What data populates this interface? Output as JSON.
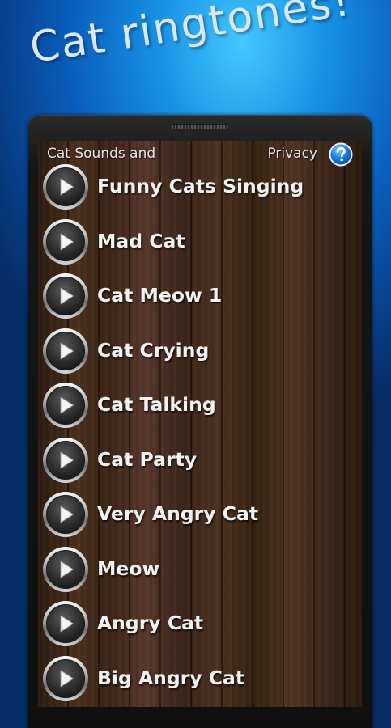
{
  "banner": {
    "title": "Cat ringtones!"
  },
  "header": {
    "left_label": "Cat Sounds and",
    "right_label": "Privacy",
    "help_icon": "question-mark-icon"
  },
  "play_icon": "play-icon",
  "sounds": [
    {
      "title": "Funny Cats Singing"
    },
    {
      "title": "Mad Cat"
    },
    {
      "title": "Cat Meow 1"
    },
    {
      "title": "Cat Crying"
    },
    {
      "title": "Cat Talking"
    },
    {
      "title": "Cat Party"
    },
    {
      "title": "Very Angry Cat"
    },
    {
      "title": "Meow"
    },
    {
      "title": "Angry Cat"
    },
    {
      "title": "Big Angry Cat"
    }
  ]
}
